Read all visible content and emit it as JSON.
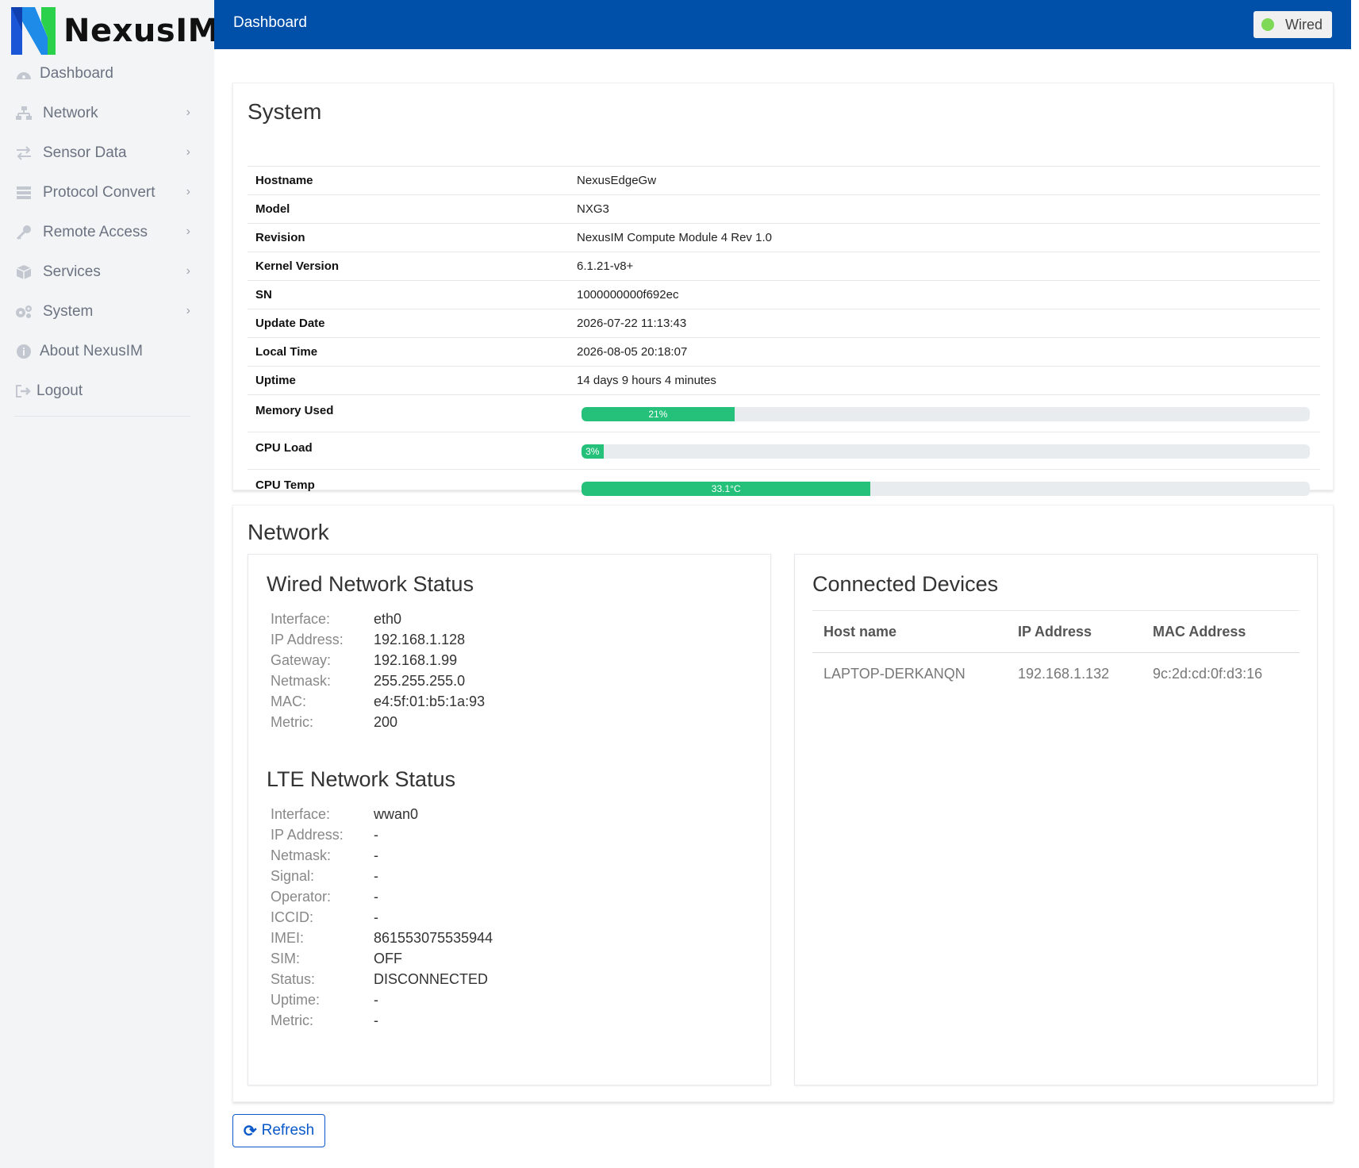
{
  "app": {
    "name": "NexusIM"
  },
  "sidebar": {
    "items": [
      {
        "label": "Dashboard",
        "icon": "dashboard-icon",
        "has_submenu": false
      },
      {
        "label": "Network",
        "icon": "network-icon",
        "has_submenu": true
      },
      {
        "label": "Sensor Data",
        "icon": "exchange-icon",
        "has_submenu": true
      },
      {
        "label": "Protocol Convert",
        "icon": "list-icon",
        "has_submenu": true
      },
      {
        "label": "Remote Access",
        "icon": "key-icon",
        "has_submenu": true
      },
      {
        "label": "Services",
        "icon": "cube-icon",
        "has_submenu": true
      },
      {
        "label": "System",
        "icon": "gears-icon",
        "has_submenu": true
      },
      {
        "label": "About NexusIM",
        "icon": "info-icon",
        "has_submenu": false
      },
      {
        "label": "Logout",
        "icon": "logout-icon",
        "has_submenu": false
      }
    ]
  },
  "header": {
    "title": "Dashboard",
    "connection_label": "Wired",
    "connection_color": "#7ed957",
    "bar_color": "#0050aa"
  },
  "system": {
    "title": "System",
    "rows": [
      {
        "label": "Hostname",
        "value": "NexusEdgeGw"
      },
      {
        "label": "Model",
        "value": "NXG3"
      },
      {
        "label": "Revision",
        "value": "NexusIM Compute Module 4 Rev 1.0"
      },
      {
        "label": "Kernel Version",
        "value": "6.1.21-v8+"
      },
      {
        "label": "SN",
        "value": "1000000000f692ec"
      },
      {
        "label": "Update Date",
        "value": "2026-07-22 11:13:43"
      },
      {
        "label": "Local Time",
        "value": "2026-08-05 20:18:07"
      },
      {
        "label": "Uptime",
        "value": "14 days 9 hours 4 minutes"
      }
    ],
    "bars": [
      {
        "label": "Memory Used",
        "text": "21%",
        "fraction": 0.21
      },
      {
        "label": "CPU Load",
        "text": "3%",
        "fraction": 0.03
      },
      {
        "label": "CPU Temp",
        "text": "33.1°C",
        "fraction": 0.397
      }
    ],
    "bar_color": "#25c17a"
  },
  "network": {
    "title": "Network",
    "wired": {
      "title": "Wired Network Status",
      "rows": [
        {
          "label": "Interface:",
          "value": "eth0"
        },
        {
          "label": "IP Address:",
          "value": "192.168.1.128"
        },
        {
          "label": "Gateway:",
          "value": "192.168.1.99"
        },
        {
          "label": "Netmask:",
          "value": "255.255.255.0"
        },
        {
          "label": "MAC:",
          "value": "e4:5f:01:b5:1a:93"
        },
        {
          "label": "Metric:",
          "value": "200"
        }
      ]
    },
    "lte": {
      "title": "LTE Network Status",
      "rows": [
        {
          "label": "Interface:",
          "value": "wwan0"
        },
        {
          "label": "IP Address:",
          "value": "-"
        },
        {
          "label": "Netmask:",
          "value": "-"
        },
        {
          "label": "Signal:",
          "value": "-"
        },
        {
          "label": "Operator:",
          "value": "-"
        },
        {
          "label": "ICCID:",
          "value": "-"
        },
        {
          "label": "IMEI:",
          "value": "861553075535944"
        },
        {
          "label": "SIM:",
          "value": "OFF"
        },
        {
          "label": "Status:",
          "value": "DISCONNECTED"
        },
        {
          "label": "Uptime:",
          "value": "-"
        },
        {
          "label": "Metric:",
          "value": "-"
        }
      ]
    },
    "devices": {
      "title": "Connected Devices",
      "columns": [
        "Host name",
        "IP Address",
        "MAC Address"
      ],
      "rows": [
        [
          "LAPTOP-DERKANQN",
          "192.168.1.132",
          "9c:2d:cd:0f:d3:16"
        ]
      ]
    }
  },
  "actions": {
    "refresh_label": "Refresh"
  }
}
